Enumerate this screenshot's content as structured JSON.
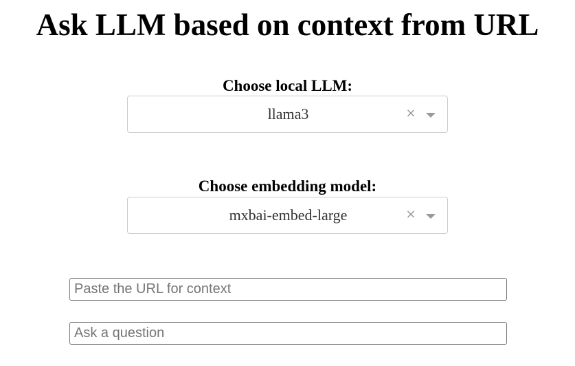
{
  "page": {
    "title": "Ask LLM based on context from URL"
  },
  "llm_select": {
    "label": "Choose local LLM:",
    "value": "llama3",
    "clear_symbol": "×"
  },
  "embedding_select": {
    "label": "Choose embedding model:",
    "value": "mxbai-embed-large",
    "clear_symbol": "×"
  },
  "url_input": {
    "placeholder": "Paste the URL for context",
    "value": ""
  },
  "question_input": {
    "placeholder": "Ask a question",
    "value": ""
  },
  "icons": {
    "clear": "close-icon",
    "dropdown": "chevron-down-icon"
  },
  "colors": {
    "select_border": "#cccccc",
    "indicator": "#999999",
    "input_border": "#767676",
    "placeholder": "#757575"
  }
}
